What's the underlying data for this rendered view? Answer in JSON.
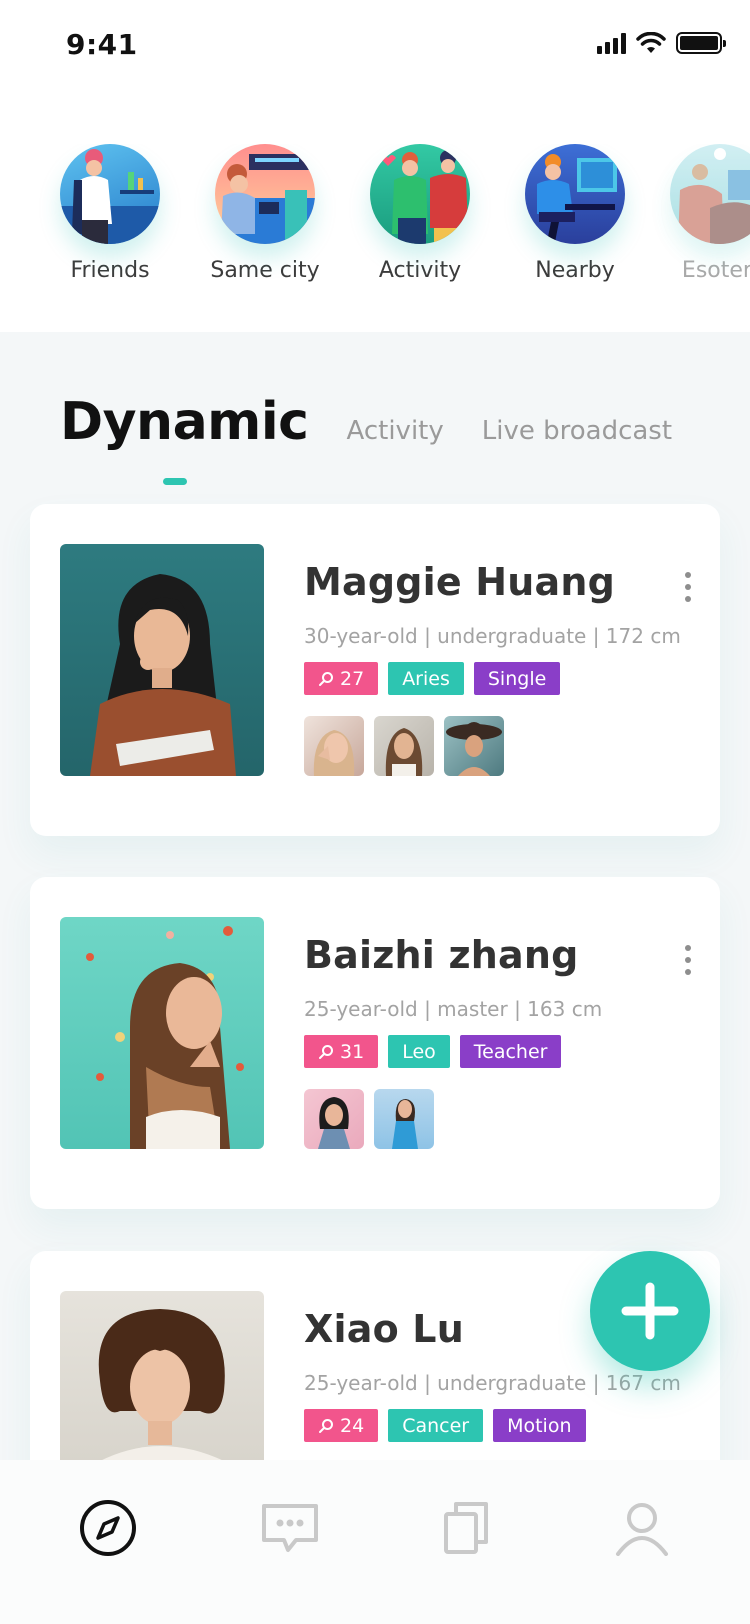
{
  "status_bar": {
    "time": "9:41"
  },
  "categories": [
    {
      "label": "Friends",
      "icon": "friends-illustration-icon"
    },
    {
      "label": "Same city",
      "icon": "same-city-illustration-icon"
    },
    {
      "label": "Activity",
      "icon": "activity-illustration-icon"
    },
    {
      "label": "Nearby",
      "icon": "nearby-illustration-icon"
    },
    {
      "label": "Esoteri",
      "icon": "esoteric-illustration-icon"
    }
  ],
  "tabs": {
    "active": "Dynamic",
    "items": [
      "Activity",
      "Live broadcast"
    ]
  },
  "cards": [
    {
      "name": "Maggie Huang",
      "meta": "30-year-old | undergraduate | 172 cm",
      "likes": "27",
      "sign": "Aries",
      "status": "Single",
      "thumb_count": 3
    },
    {
      "name": "Baizhi zhang",
      "meta": "25-year-old | master | 163 cm",
      "likes": "31",
      "sign": "Leo",
      "status": "Teacher",
      "thumb_count": 2
    },
    {
      "name": "Xiao Lu",
      "meta": "25-year-old | undergraduate | 167 cm",
      "likes": "24",
      "sign": "Cancer",
      "status": "Motion",
      "thumb_count": 0
    }
  ],
  "bottom_nav": [
    {
      "icon": "compass-icon",
      "active": true
    },
    {
      "icon": "chat-icon",
      "active": false
    },
    {
      "icon": "cards-icon",
      "active": false
    },
    {
      "icon": "profile-icon",
      "active": false
    }
  ],
  "colors": {
    "accent": "#2dc5b1",
    "likes": "#f2558c",
    "status": "#8a3ec8",
    "background": "#f4f7f8"
  }
}
